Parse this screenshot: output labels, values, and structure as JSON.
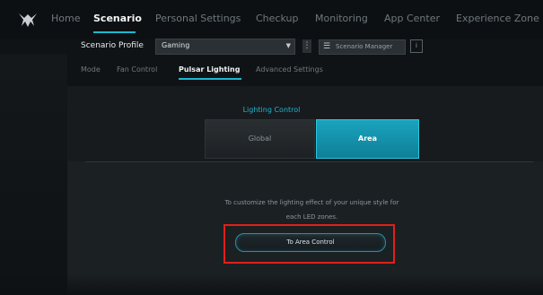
{
  "nav": {
    "logo_icon": "predator-logo-icon",
    "items": [
      "Home",
      "Scenario",
      "Personal Settings",
      "Checkup",
      "Monitoring",
      "App Center",
      "Experience Zone"
    ],
    "active": "Scenario"
  },
  "profile": {
    "label": "Scenario Profile",
    "value": "Gaming",
    "dropdown_icon": "chevron-down-icon",
    "menu_icon": "kebab-icon",
    "manager_label": "Scenario Manager",
    "manager_icon": "list-icon",
    "info_icon": "info-icon"
  },
  "subtabs": {
    "items": [
      "Mode",
      "Fan Control",
      "Pulsar Lighting",
      "Advanced Settings"
    ],
    "active": "Pulsar Lighting"
  },
  "lighting": {
    "title": "Lighting Control",
    "options": [
      "Global",
      "Area"
    ],
    "selected": "Area"
  },
  "description": {
    "line1": "To customize the lighting effect of your unique style for",
    "line2": "each LED zones."
  },
  "cta": {
    "label": "To Area Control"
  },
  "colors": {
    "accent": "#1bb8d0",
    "highlight": "#e0201a"
  }
}
